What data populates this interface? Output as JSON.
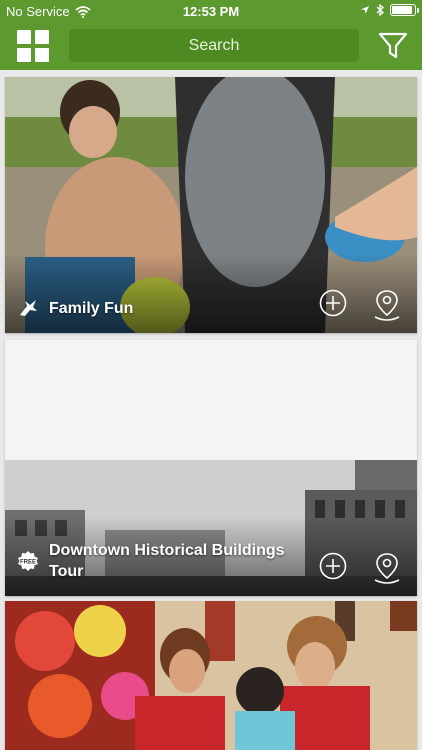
{
  "status_bar": {
    "carrier": "No Service",
    "time": "12:53 PM",
    "battery_level": 0.9
  },
  "navbar": {
    "menu_icon": "grid-icon",
    "search_label": "Search",
    "filter_icon": "filter-icon"
  },
  "colors": {
    "brand_green": "#5c9a2f",
    "search_green": "#4d8a22"
  },
  "cards": [
    {
      "title": "Family Fun",
      "category_icon": "family-fun-icon",
      "add_icon": "plus-circle-icon",
      "map_icon": "map-pin-icon"
    },
    {
      "title": "Downtown Historical Buildings Tour",
      "category_icon": "free-badge-icon",
      "badge_text": "FREE",
      "add_icon": "plus-circle-icon",
      "map_icon": "map-pin-icon"
    },
    {
      "title": "",
      "category_icon": "",
      "add_icon": "",
      "map_icon": ""
    }
  ]
}
